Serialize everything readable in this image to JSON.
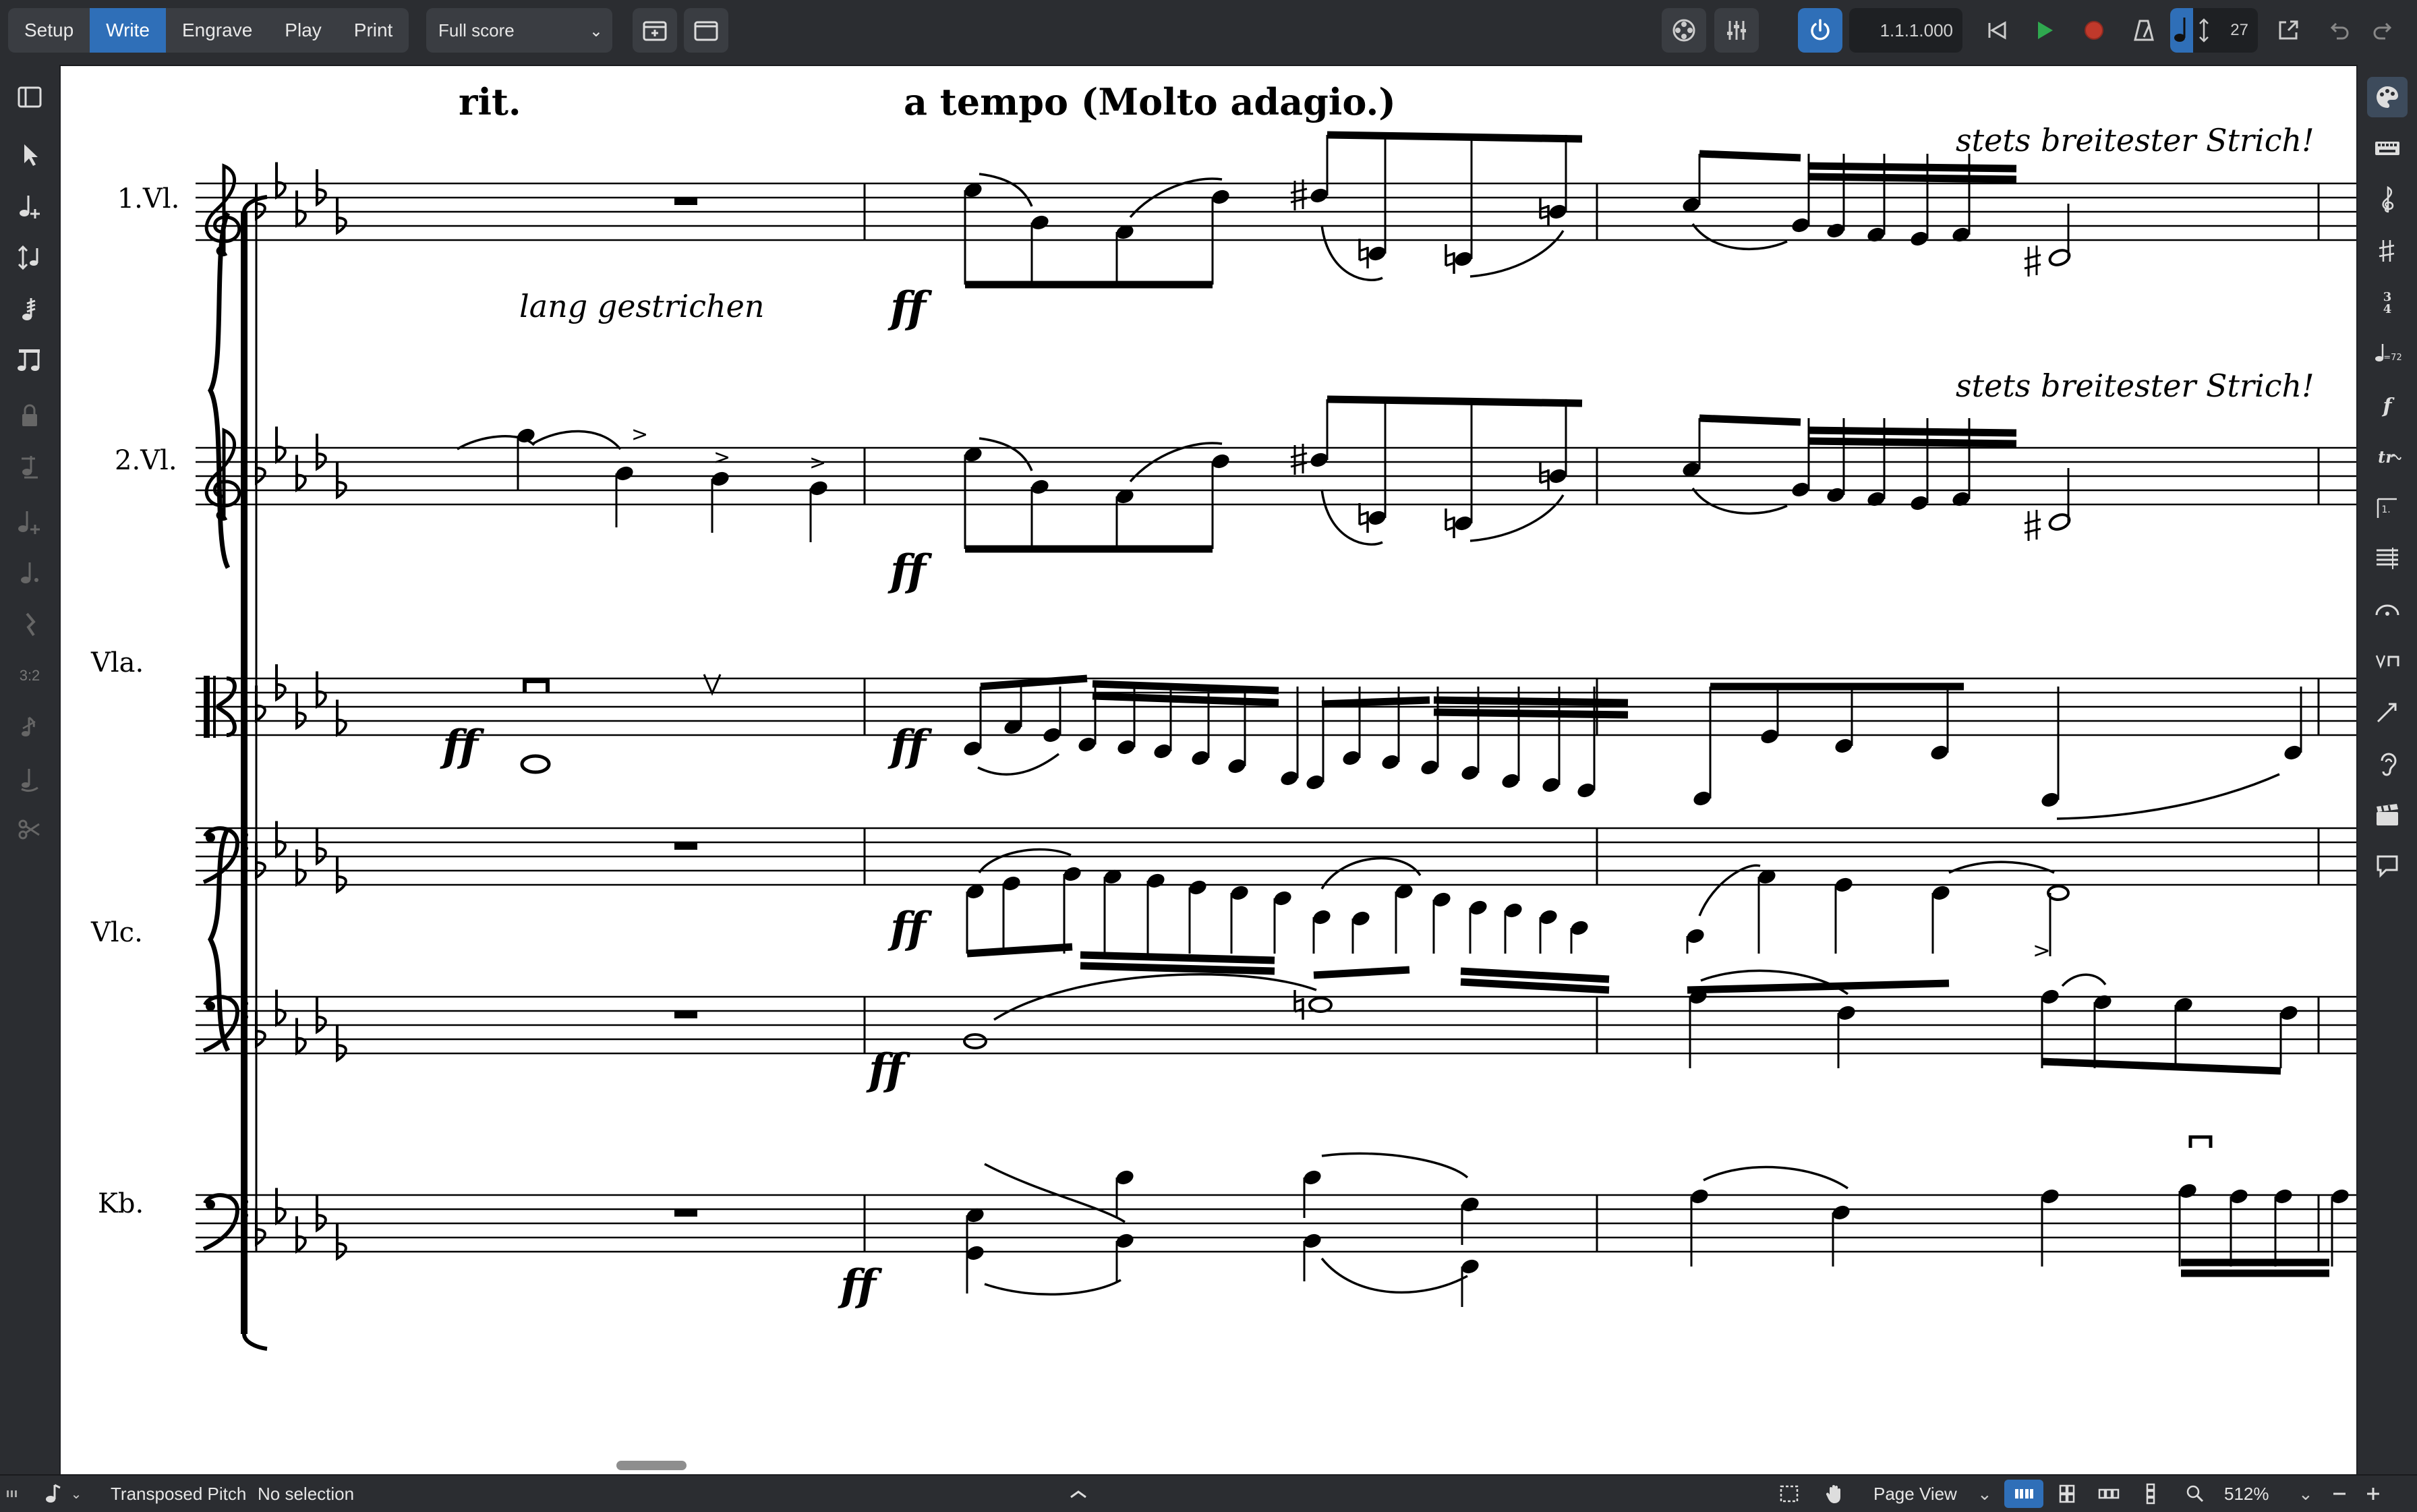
{
  "toolbar": {
    "modes": [
      "Setup",
      "Write",
      "Engrave",
      "Play",
      "Print"
    ],
    "active_mode": "Write",
    "layout_select": "Full score",
    "transport_position": "1.1.1.000",
    "tempo_value": "27"
  },
  "left_panel": {
    "tools": [
      "panel-toggle-icon",
      "select-icon",
      "note-input-icon",
      "transpose-icon",
      "tremolo-icon",
      "beam-icon",
      "lock-icon",
      "insert-icon",
      "add-note-icon",
      "dot-icon",
      "rest-icon",
      "tuplet-icon",
      "grace-note-icon",
      "tie-icon",
      "scissors-icon"
    ],
    "tuplet_label": "3:2"
  },
  "right_panel": {
    "tools": [
      "properties-icon",
      "keyboard-icon",
      "clef-icon",
      "key-signature-icon",
      "time-signature-icon",
      "tempo-icon",
      "dynamics-icon",
      "ornaments-icon",
      "repeat-icon",
      "tremolo-bars-icon",
      "fermata-icon",
      "bowing-icon",
      "lines-icon",
      "playing-technique-icon",
      "cue-icon",
      "comment-icon"
    ],
    "tempo_label": "♩=72"
  },
  "score": {
    "instruments": [
      "1.Vl.",
      "2.Vl.",
      "Vla.",
      "Vlc.",
      "Kb."
    ],
    "tempo_marks": [
      "rit.",
      "a tempo (Molto adagio.)"
    ],
    "expressions": [
      "lang gestrichen",
      "stets breitester Strich!",
      "stets breitester Strich!"
    ],
    "dynamic": "ff"
  },
  "statusbar": {
    "transposed_pitch": "Transposed Pitch",
    "selection": "No selection",
    "view": "Page View",
    "zoom": "512%"
  },
  "colors": {
    "accent": "#2f6fb8",
    "panel": "#2b2d31",
    "play": "#2fa84f",
    "record": "#c0392b"
  }
}
